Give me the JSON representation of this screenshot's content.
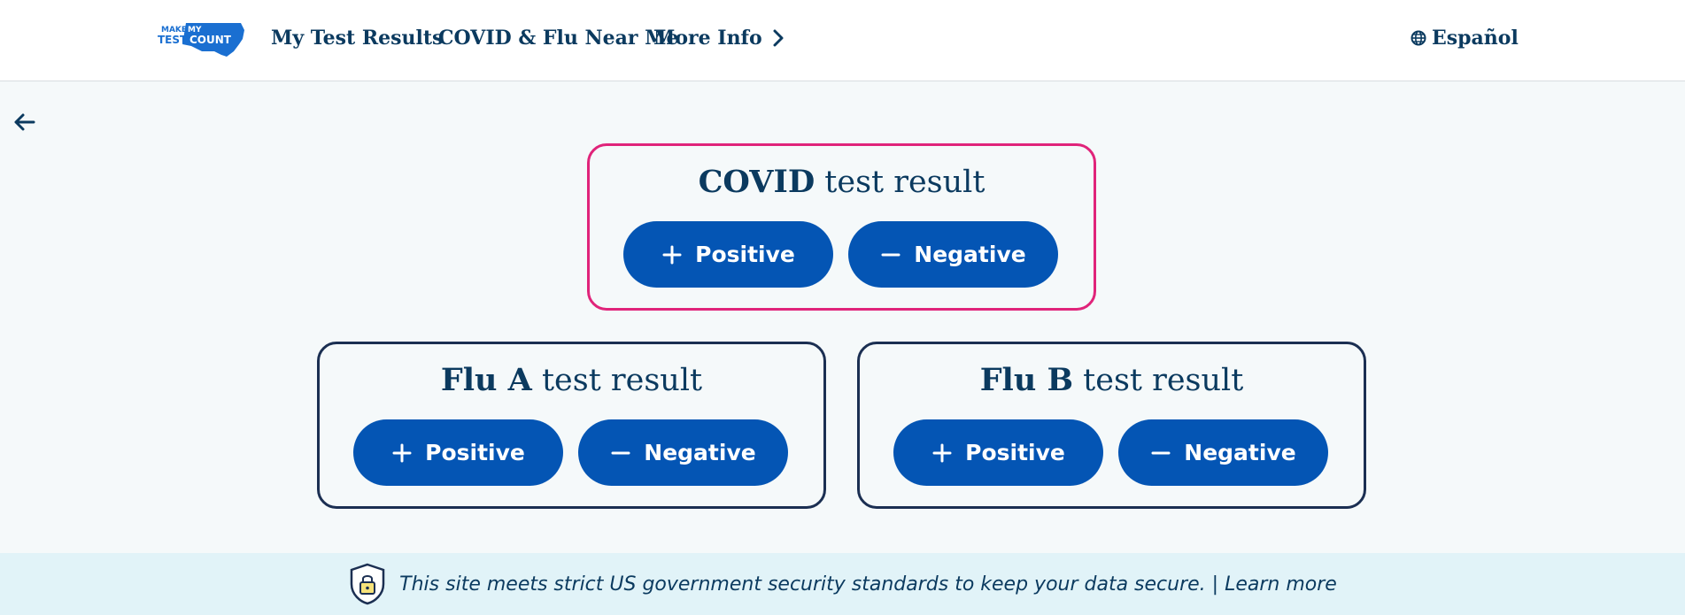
{
  "logo": {
    "line1": "MAKE",
    "line2": "MY",
    "line3": "TEST",
    "line4": "COUNT"
  },
  "nav": {
    "my_test_results": "My Test Results",
    "covid_flu_near_me": "COVID & Flu Near Me",
    "more_info": "More Info"
  },
  "language": "Español",
  "cards": {
    "covid": {
      "title_strong": "COVID",
      "title_rest": " test result",
      "positive": "Positive",
      "negative": "Negative"
    },
    "flu_a": {
      "title_strong": "Flu A",
      "title_rest": " test result",
      "positive": "Positive",
      "negative": "Negative"
    },
    "flu_b": {
      "title_strong": "Flu B",
      "title_rest": " test result",
      "positive": "Positive",
      "negative": "Negative"
    }
  },
  "banner": {
    "text": "This site meets strict US government security standards to keep your data secure.",
    "separator": " | ",
    "link": "Learn more"
  },
  "colors": {
    "primary_button": "#0455b4",
    "active_card_border": "#e0247a",
    "card_border": "#1b2f52",
    "text": "#0b3a5f",
    "banner_bg": "#e1f3f8"
  }
}
